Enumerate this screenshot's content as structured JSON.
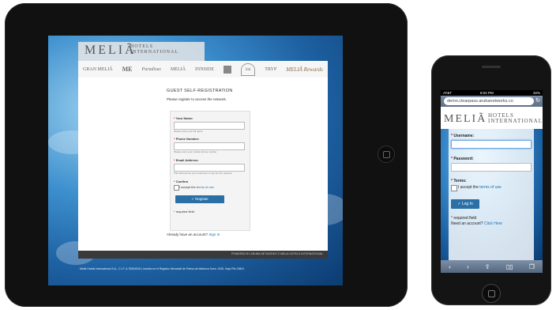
{
  "tablet": {
    "brand": {
      "logo": "MELIÃ",
      "logo_sub": "HOTELS INTERNATIONAL"
    },
    "brands": [
      "GRAN MELIÃ",
      "ME",
      "Paradisus",
      "MELIÃ",
      "INNSIDE",
      "Sol",
      "TRYP",
      "MELIÃ Rewards"
    ],
    "title": "GUEST SELF-REGISTRATION",
    "intro": "Please register to access the network.",
    "form": {
      "name_label": "Your Name:",
      "name_hint": "Please enter your full name.",
      "phone_label": "Phone Number:",
      "phone_hint": "Please enter your contact phone number.",
      "email_label": "Email Address:",
      "email_hint": "This will become your username to log into the network.",
      "confirm_label": "Confirm",
      "terms_prefix": "I accept the",
      "terms_link": "terms of use",
      "register_button": "Register",
      "required_note": "required field"
    },
    "already_prefix": "Already have an account?",
    "signin_link": "Sign In",
    "footer": "POWERED BY ARUBA NETWORKS © MELIA HOTELS INTERNATIONAL",
    "legal": "Meliá Hotels International S.A., C.I.F. A-78304516 | Inscrita en el Registro Mercantil de Palma de Mallorca Tomo 1335, Hoja PM-23601"
  },
  "phone": {
    "status": {
      "carrier": "AT&T",
      "time": "8:02 PM",
      "battery": "32%"
    },
    "url": "demo.clearpass.arubanetworks.co",
    "brand": {
      "logo": "MELIÃ",
      "logo_sub_1": "HOTELS",
      "logo_sub_2": "INTERNATIONAL"
    },
    "form": {
      "username_label": "Username:",
      "password_label": "Password:",
      "terms_label": "Terms:",
      "terms_prefix": "I accept the",
      "terms_link": "terms of use",
      "login_button": "Log In",
      "required_note": "required field",
      "need_account_prefix": "Need an account?",
      "click_here_link": "Click Here"
    },
    "toolbar": [
      "‹",
      "›",
      "⇪",
      "▯▯",
      "❐"
    ]
  }
}
